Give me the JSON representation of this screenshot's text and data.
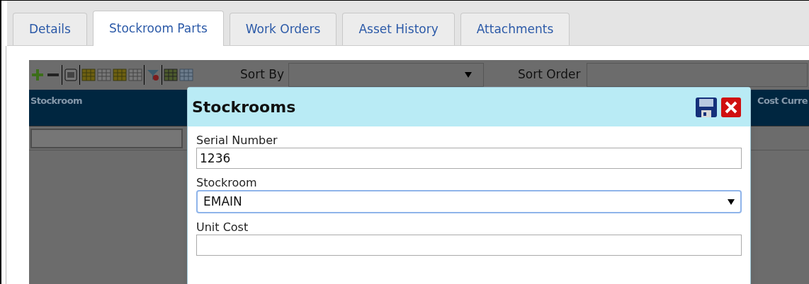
{
  "tabs": [
    {
      "label": "Details",
      "selected": false
    },
    {
      "label": "Stockroom Parts",
      "selected": true
    },
    {
      "label": "Work Orders",
      "selected": false
    },
    {
      "label": "Asset History",
      "selected": false
    },
    {
      "label": "Attachments",
      "selected": false
    }
  ],
  "toolbar": {
    "sort_by": {
      "label": "Sort By"
    },
    "sort_order": {
      "label": "Sort Order"
    }
  },
  "grid": {
    "columns": [
      "Stockroom",
      "Cost Curre"
    ]
  },
  "dialog": {
    "title": "Stockrooms",
    "fields": [
      {
        "kind": "text",
        "label": "Serial Number",
        "value": "1236"
      },
      {
        "kind": "select",
        "label": "Stockroom",
        "value": "EMAIN"
      },
      {
        "kind": "text",
        "label": "Unit Cost"
      }
    ]
  }
}
